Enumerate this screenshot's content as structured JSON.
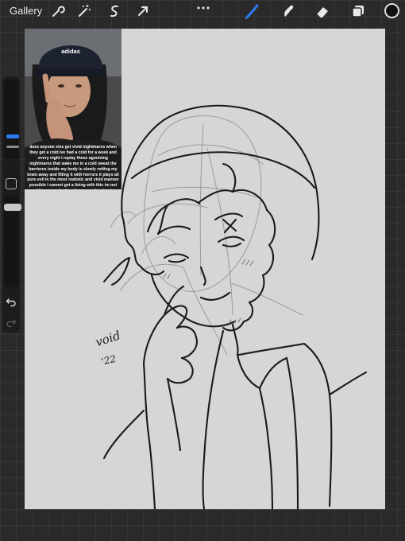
{
  "topbar": {
    "gallery_label": "Gallery",
    "tools_left": [
      "wrench-icon",
      "magic-wand-icon",
      "selection-icon",
      "transform-arrow-icon"
    ],
    "tools_right": [
      "brush-icon",
      "smudge-icon",
      "eraser-icon",
      "layers-icon"
    ],
    "active_tool": "brush-icon",
    "current_color": "#111111",
    "accent_color": "#2a7cf4"
  },
  "sidebar": {
    "items": [
      "brush-size-slider",
      "modify-button",
      "opacity-slider",
      "undo-icon",
      "redo-icon"
    ]
  },
  "canvas": {
    "reference_photo": {
      "cap_text": "adidas",
      "caption": "does anyone else get vivid nightmares when they get a cold ive had a cold for a week and every night i replay these agonizing nightmares that wake me in a cold sweat the barrieres inside my body is slowly rotting my brain away and filling it with horrors it plays all pure evil in the most realistic and vivid manner possible i cannot get a living with this im not getting enough sleep because sleeping is painful oh boy at least i know what nightmares"
    },
    "signature": {
      "line1": "void",
      "line2": "'22"
    }
  }
}
